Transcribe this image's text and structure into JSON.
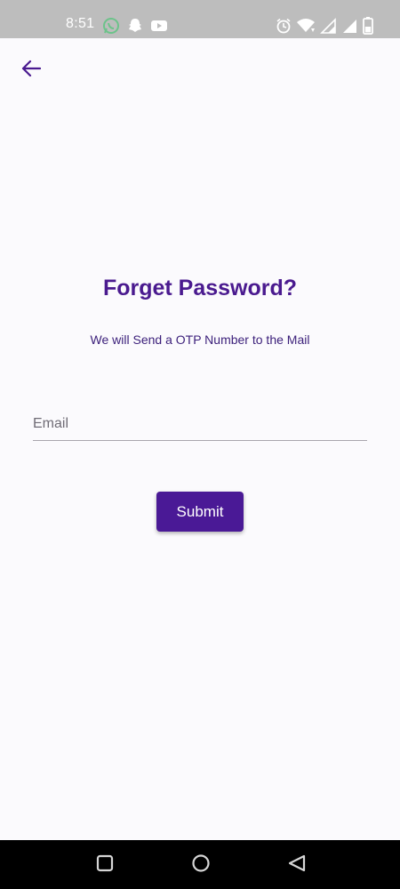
{
  "status_bar": {
    "time": "8:51",
    "left_icons": [
      "whatsapp-icon",
      "snapchat-icon",
      "youtube-icon"
    ],
    "right_icons": [
      "alarm-icon",
      "wifi-icon",
      "signal-icon",
      "signal-icon",
      "battery-icon"
    ]
  },
  "header": {
    "back_icon": "arrow-left-icon"
  },
  "main": {
    "title": "Forget Password?",
    "subtitle": "We will Send a OTP Number to the Mail",
    "email_placeholder": "Email",
    "email_value": "",
    "submit_label": "Submit"
  },
  "nav_bar": {
    "buttons": [
      "square-icon",
      "circle-icon",
      "triangle-back-icon"
    ]
  },
  "colors": {
    "accent": "#4a1996",
    "title": "#4a1a8f",
    "background": "#fbfafd",
    "status_bar": "#bdbdbd",
    "nav_bar": "#000000"
  }
}
